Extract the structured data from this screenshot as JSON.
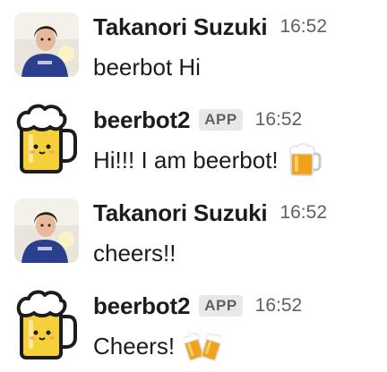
{
  "messages": [
    {
      "sender": "Takanori Suzuki",
      "time": "16:52",
      "text": "beerbot Hi",
      "is_app": false,
      "avatar": "user-avatar-photo"
    },
    {
      "sender": "beerbot2",
      "badge": "APP",
      "time": "16:52",
      "text": "Hi!!! I am beerbot!",
      "is_app": true,
      "avatar": "beer-mug-avatar",
      "emoji": "beer-mug-emoji"
    },
    {
      "sender": "Takanori Suzuki",
      "time": "16:52",
      "text": "cheers!!",
      "is_app": false,
      "avatar": "user-avatar-photo"
    },
    {
      "sender": "beerbot2",
      "badge": "APP",
      "time": "16:52",
      "text": "Cheers!",
      "is_app": true,
      "avatar": "beer-mug-avatar",
      "emoji": "clinking-beer-mugs-emoji"
    }
  ],
  "colors": {
    "text": "#1d1c1d",
    "muted": "#616061",
    "badge_bg": "#e8e8e8",
    "beer": "#f5d03a",
    "foam": "#ffffff"
  }
}
